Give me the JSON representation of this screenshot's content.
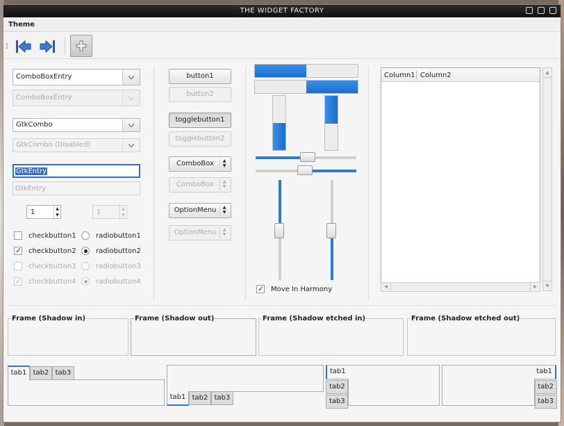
{
  "window": {
    "title": "THE WIDGET FACTORY"
  },
  "menu": {
    "theme": "Theme"
  },
  "toolbar": {
    "back_icon": "go-back-icon",
    "forward_icon": "go-forward-icon",
    "add_icon": "add-icon"
  },
  "combos": {
    "combobox_entry": "ComboBoxEntry",
    "combobox_entry_disabled": "ComboBoxEntry",
    "gtkcombo": "GtkCombo",
    "gtkcombo_disabled": "GtkCombo (Disabled)"
  },
  "entries": {
    "entry": "GtkEntry",
    "entry_disabled": "GtkEntry"
  },
  "spins": {
    "spin1": "1",
    "spin2": "1"
  },
  "checks": [
    {
      "label": "checkbutton1",
      "checked": false,
      "disabled": false
    },
    {
      "label": "checkbutton2",
      "checked": true,
      "disabled": false
    },
    {
      "label": "checkbutton3",
      "checked": false,
      "disabled": true
    },
    {
      "label": "checkbutton4",
      "checked": true,
      "disabled": true
    }
  ],
  "radios": [
    {
      "label": "radiobutton1",
      "checked": false,
      "disabled": false
    },
    {
      "label": "radiobutton2",
      "checked": true,
      "disabled": false
    },
    {
      "label": "radiobutton3",
      "checked": false,
      "disabled": true
    },
    {
      "label": "radiobutton4",
      "checked": true,
      "disabled": true
    }
  ],
  "buttons": {
    "button1": "button1",
    "button2": "button2",
    "toggle1": "togglebutton1",
    "toggle2": "togglebutton2",
    "combobox": "ComboBox",
    "combobox_disabled": "ComboBox",
    "optionmenu": "OptionMenu",
    "optionmenu_disabled": "OptionMenu"
  },
  "progress": {
    "h1": 0.5,
    "h2": 0.5,
    "v1": 0.5,
    "v2": 0.5
  },
  "sliders": {
    "h1": 0.5,
    "h2": 0.5,
    "v1": 0.5,
    "v2": 0.5
  },
  "harmony": {
    "label": "Move In Harmony",
    "checked": true
  },
  "tree": {
    "columns": [
      "Column1",
      "Column2"
    ]
  },
  "frames": [
    "Frame (Shadow in)",
    "Frame (Shadow out)",
    "Frame (Shadow etched in)",
    "Frame (Shadow etched out)"
  ],
  "notebooks": {
    "tabs": [
      "tab1",
      "tab2",
      "tab3"
    ]
  }
}
